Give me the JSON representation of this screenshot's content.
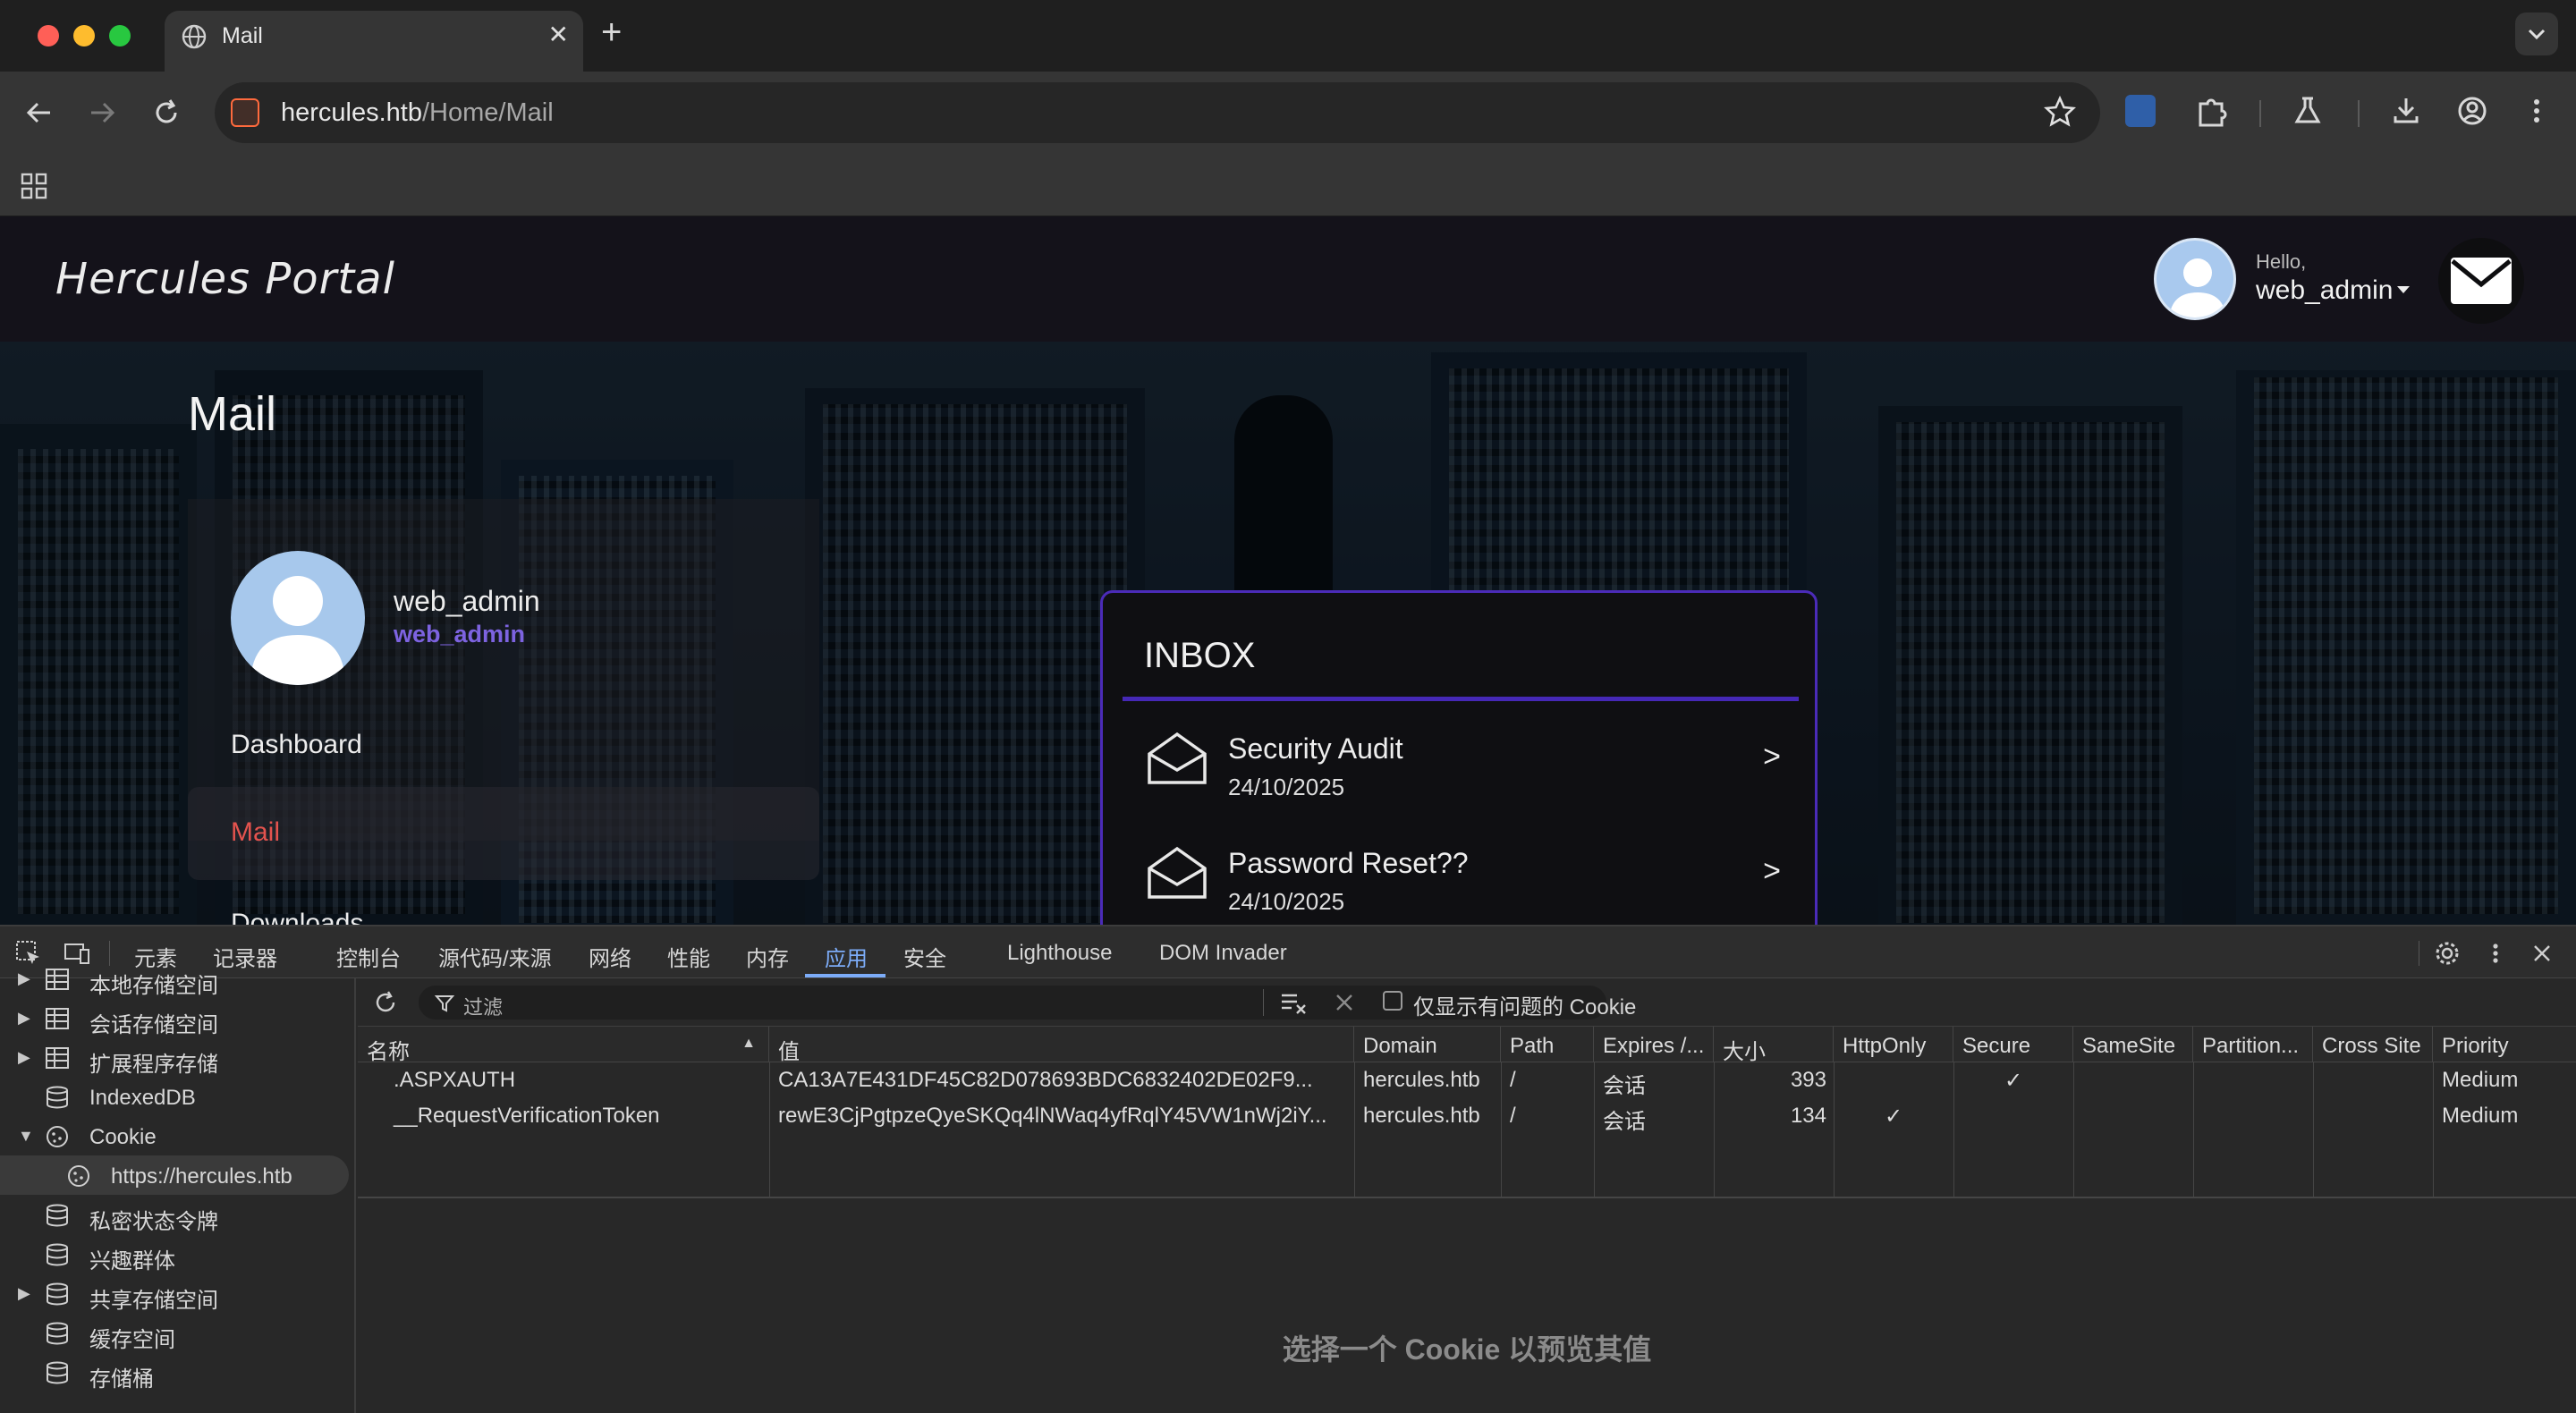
{
  "browser": {
    "tab_title": "Mail",
    "url_host": "hercules.htb",
    "url_path": "/Home/Mail"
  },
  "site": {
    "brand": "Hercules Portal",
    "header": {
      "hello": "Hello,",
      "username": "web_admin"
    },
    "page_title": "Mail",
    "profile": {
      "name": "web_admin",
      "role": "web_admin"
    },
    "nav": {
      "dashboard": "Dashboard",
      "mail": "Mail",
      "partial_next": "Downloads"
    },
    "inbox": {
      "title": "INBOX",
      "messages": [
        {
          "subject": "Security Audit",
          "date": "24/10/2025",
          "arrow": ">"
        },
        {
          "subject": "Password Reset??",
          "date": "24/10/2025",
          "arrow": ">"
        }
      ]
    }
  },
  "devtools": {
    "tabs": [
      "元素",
      "记录器",
      "控制台",
      "源代码/来源",
      "网络",
      "性能",
      "内存",
      "应用",
      "安全",
      "Lighthouse",
      "DOM Invader"
    ],
    "active_tab": "应用",
    "sidebar": [
      {
        "label": "本地存储空间",
        "arrow": "▶",
        "icon": "table-icon"
      },
      {
        "label": "会话存储空间",
        "arrow": "▶",
        "icon": "table-icon"
      },
      {
        "label": "扩展程序存储",
        "arrow": "▶",
        "icon": "table-icon"
      },
      {
        "label": "IndexedDB",
        "arrow": "",
        "icon": "database-icon"
      },
      {
        "label": "Cookie",
        "arrow": "▼",
        "icon": "cookie-icon"
      },
      {
        "label": "https://hercules.htb",
        "arrow": "",
        "icon": "cookie-icon"
      },
      {
        "label": "私密状态令牌",
        "arrow": "",
        "icon": "database-icon"
      },
      {
        "label": "兴趣群体",
        "arrow": "",
        "icon": "database-icon"
      },
      {
        "label": "共享存储空间",
        "arrow": "▶",
        "icon": "database-icon"
      },
      {
        "label": "缓存空间",
        "arrow": "",
        "icon": "database-icon"
      },
      {
        "label": "存储桶",
        "arrow": "",
        "icon": "database-icon"
      }
    ],
    "filter_placeholder": "过滤",
    "only_issues_label": "仅显示有问题的 Cookie",
    "columns": [
      "名称",
      "值",
      "Domain",
      "Path",
      "Expires /...",
      "大小",
      "HttpOnly",
      "Secure",
      "SameSite",
      "Partition...",
      "Cross Site",
      "Priority"
    ],
    "rows": [
      {
        "name": ".ASPXAUTH",
        "value": "CA13A7E431DF45C82D078693BDC6832402DE02F9...",
        "domain": "hercules.htb",
        "path": "/",
        "expires": "会话",
        "size": "393",
        "httponly": "",
        "secure": "✓",
        "samesite": "",
        "partition": "",
        "crosssite": "",
        "priority": "Medium"
      },
      {
        "name": "__RequestVerificationToken",
        "value": "rewE3CjPgtpzeQyeSKQq4lNWaq4yfRqlY45VW1nWj2iY...",
        "domain": "hercules.htb",
        "path": "/",
        "expires": "会话",
        "size": "134",
        "httponly": "✓",
        "secure": "",
        "samesite": "",
        "partition": "",
        "crosssite": "",
        "priority": "Medium"
      }
    ],
    "preview_hint": "选择一个 Cookie 以预览其值",
    "accent_color": "#7cacf8"
  },
  "colors": {
    "brand_purple": "#4b2bb8",
    "active_nav": "#e4534e",
    "role_text": "#7d63e0"
  }
}
